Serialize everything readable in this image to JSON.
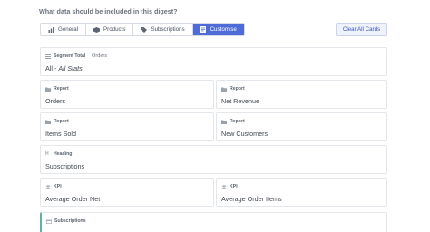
{
  "question": "What data should be included in this digest?",
  "tabs": [
    {
      "label": "General",
      "active": false,
      "icon": "chart-icon"
    },
    {
      "label": "Products",
      "active": false,
      "icon": "box-icon"
    },
    {
      "label": "Subscriptions",
      "active": false,
      "icon": "tag-icon"
    },
    {
      "label": "Customise",
      "active": true,
      "icon": "document-icon"
    }
  ],
  "clear_button": "Clear All Cards",
  "cards": [
    {
      "type": "Segment Total",
      "value": "Orders",
      "title_prefix": "All - ",
      "title_italic": "All Stats"
    },
    {
      "type": "Report",
      "title": "Orders"
    },
    {
      "type": "Report",
      "title": "Net Revenue"
    },
    {
      "type": "Report",
      "title": "Items Sold"
    },
    {
      "type": "Report",
      "title": "New Customers"
    },
    {
      "type": "Heading",
      "title": "Subscriptions"
    },
    {
      "type": "KPI",
      "title": "Average Order Net"
    },
    {
      "type": "KPI",
      "title": "Average Order Items"
    },
    {
      "type": "Subscriptions",
      "title": ""
    }
  ]
}
